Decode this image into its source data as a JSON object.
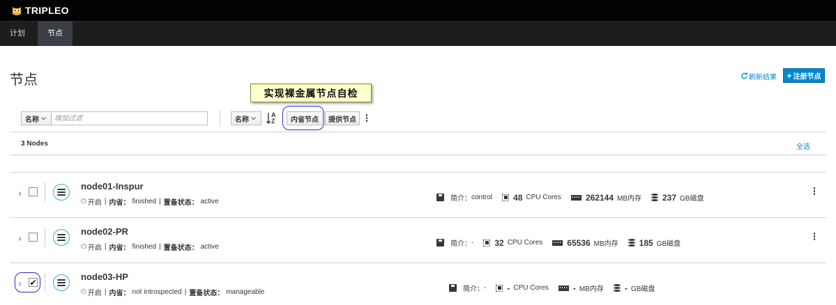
{
  "brand": {
    "name": "TRIPLEO"
  },
  "nav": {
    "tabs": [
      {
        "label": "计划"
      },
      {
        "label": "节点"
      }
    ]
  },
  "page": {
    "title": "节点"
  },
  "actions": {
    "refresh_label": "刷新结果",
    "register_label": "注册节点"
  },
  "callout": {
    "text": "实现裸金属节点自检"
  },
  "toolbar": {
    "filter_field": "名称",
    "filter_placeholder": "增加过滤",
    "sort_field": "名称",
    "sort_icon_top": "A",
    "sort_icon_bottom": "Z",
    "introspect_label": "内省节点",
    "provide_label": "提供节点"
  },
  "list": {
    "count_label": "3 Nodes",
    "select_all_label": "全选"
  },
  "nodes": [
    {
      "name": "node01-Inspur",
      "power": "开启",
      "introspect_label": "内省：",
      "introspect": "finished",
      "provision_label": "置备状态：",
      "provision": "active",
      "checked": "",
      "profile_label": "简介：",
      "profile": "control",
      "cpu": "48",
      "cpu_unit": "CPU Cores",
      "mem": "262144",
      "mem_unit": "MB内存",
      "disk": "237",
      "disk_unit": "GB磁盘"
    },
    {
      "name": "node02-PR",
      "power": "开启",
      "introspect_label": "内省：",
      "introspect": "finished",
      "provision_label": "置备状态：",
      "provision": "active",
      "checked": "",
      "profile_label": "简介：",
      "profile": "-",
      "cpu": "32",
      "cpu_unit": "CPU Cores",
      "mem": "65536",
      "mem_unit": "MB内存",
      "disk": "185",
      "disk_unit": "GB磁盘"
    },
    {
      "name": "node03-HP",
      "power": "开启",
      "introspect_label": "内省：",
      "introspect": "not introspected",
      "provision_label": "置备状态：",
      "provision": "manageable",
      "checked": "✔",
      "profile_label": "简介：",
      "profile": "-",
      "cpu": "-",
      "cpu_unit": "CPU Cores",
      "mem": "-",
      "mem_unit": "MB内存",
      "disk": "-",
      "disk_unit": "GB磁盘"
    }
  ],
  "colors": {
    "accent": "#0088ce",
    "power_on": "#3f9c35",
    "highlight": "#2a2ad0",
    "callout_bg": "#ffffcc"
  }
}
